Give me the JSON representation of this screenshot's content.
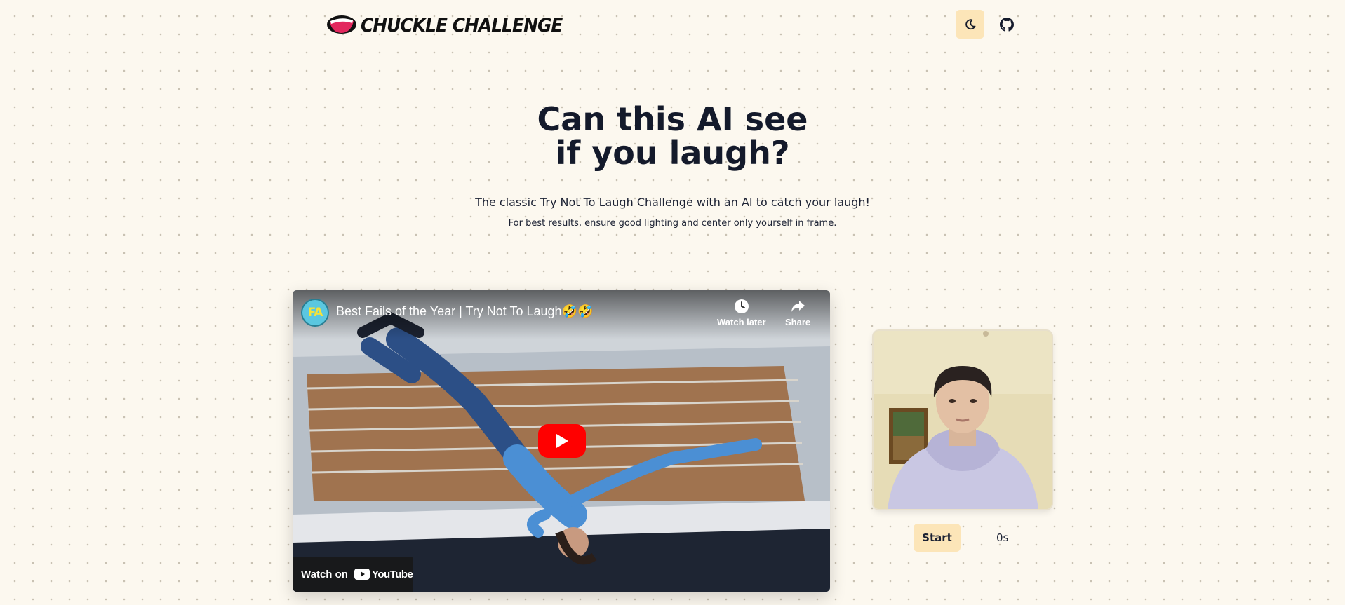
{
  "header": {
    "logo_text": "CHUCKLE CHALLENGE",
    "theme_toggle_icon": "moon-icon",
    "github_icon": "github-icon"
  },
  "hero": {
    "title_line1": "Can this AI see",
    "title_line2": "if you laugh?",
    "subtitle": "The classic Try Not To Laugh Challenge with an AI to catch your laugh!",
    "hint": "For best results, ensure good lighting and center only yourself in frame."
  },
  "video": {
    "channel_initials": "FA",
    "title": "Best Fails of the Year | Try Not To Laugh🤣🤣",
    "watch_later_label": "Watch later",
    "share_label": "Share",
    "watch_on_label": "Watch on",
    "youtube_wordmark": "YouTube"
  },
  "controls": {
    "start_label": "Start",
    "timer": "0s"
  },
  "colors": {
    "background": "#fcf8ef",
    "accent": "#fce5b8",
    "text": "#141a2b",
    "youtube_red": "#ff0000"
  }
}
